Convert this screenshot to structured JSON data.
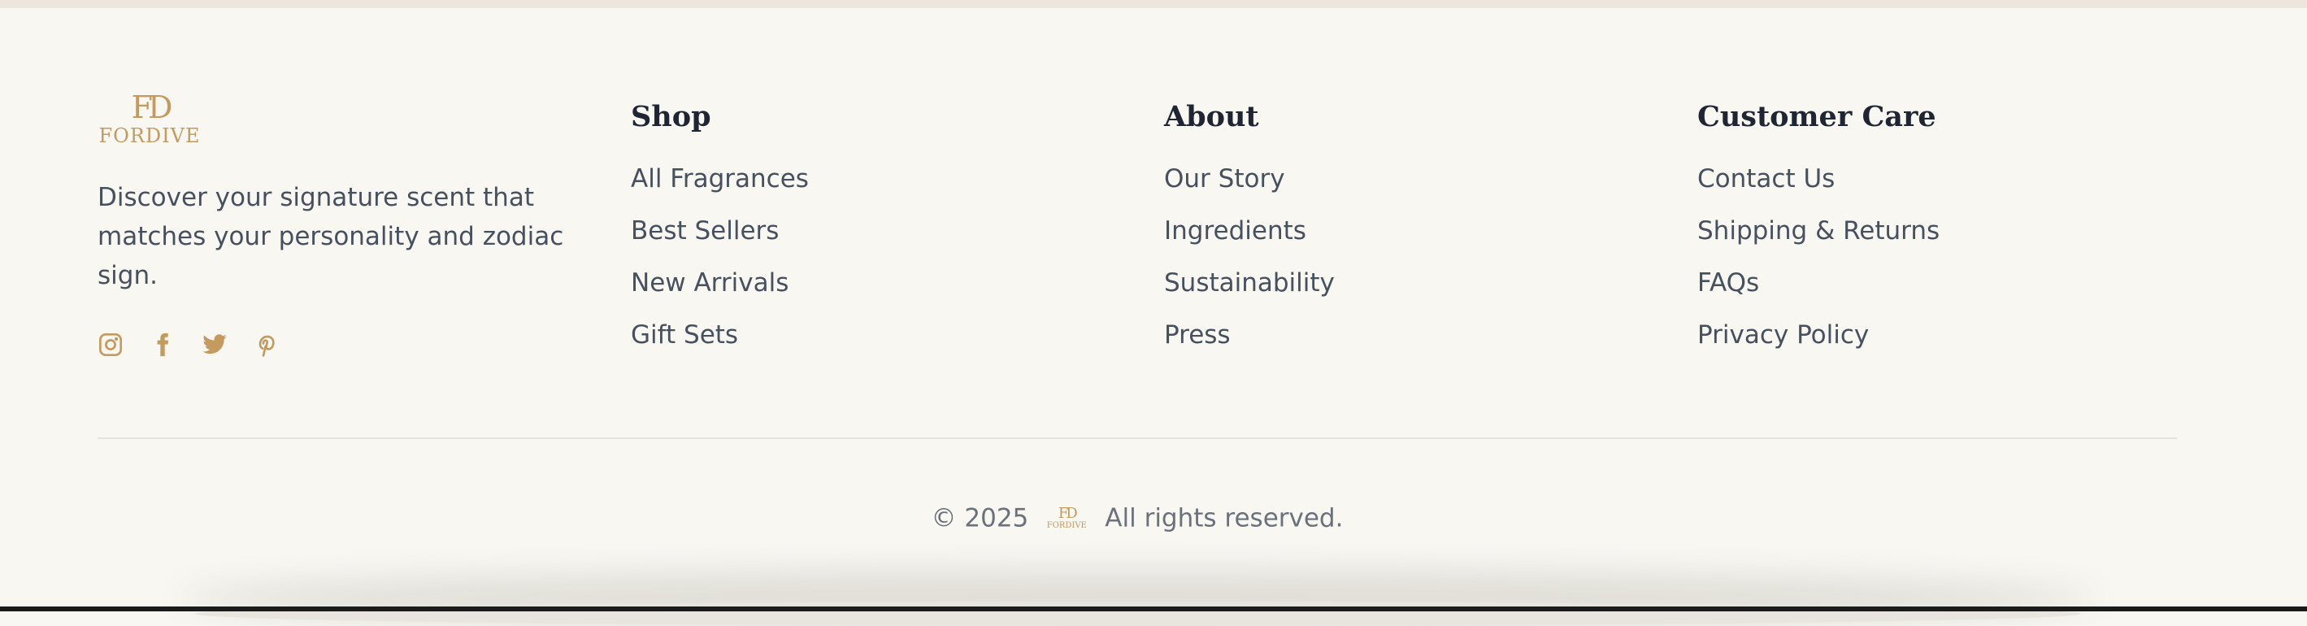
{
  "brand": {
    "logo_mark": "FD",
    "logo_wordmark": "FORDIVE",
    "tagline": "Discover your signature scent that matches your personality and zodiac sign.",
    "accent_color": "#c49a5e"
  },
  "social": [
    {
      "name": "instagram",
      "icon": "instagram-icon"
    },
    {
      "name": "facebook",
      "icon": "facebook-icon"
    },
    {
      "name": "twitter",
      "icon": "twitter-icon"
    },
    {
      "name": "pinterest",
      "icon": "pinterest-icon"
    }
  ],
  "columns": {
    "shop": {
      "heading": "Shop",
      "links": [
        "All Fragrances",
        "Best Sellers",
        "New Arrivals",
        "Gift Sets"
      ]
    },
    "about": {
      "heading": "About",
      "links": [
        "Our Story",
        "Ingredients",
        "Sustainability",
        "Press"
      ]
    },
    "care": {
      "heading": "Customer Care",
      "links": [
        "Contact Us",
        "Shipping & Returns",
        "FAQs",
        "Privacy Policy"
      ]
    }
  },
  "copyright": {
    "year": "© 2025",
    "rights": "All rights reserved."
  }
}
